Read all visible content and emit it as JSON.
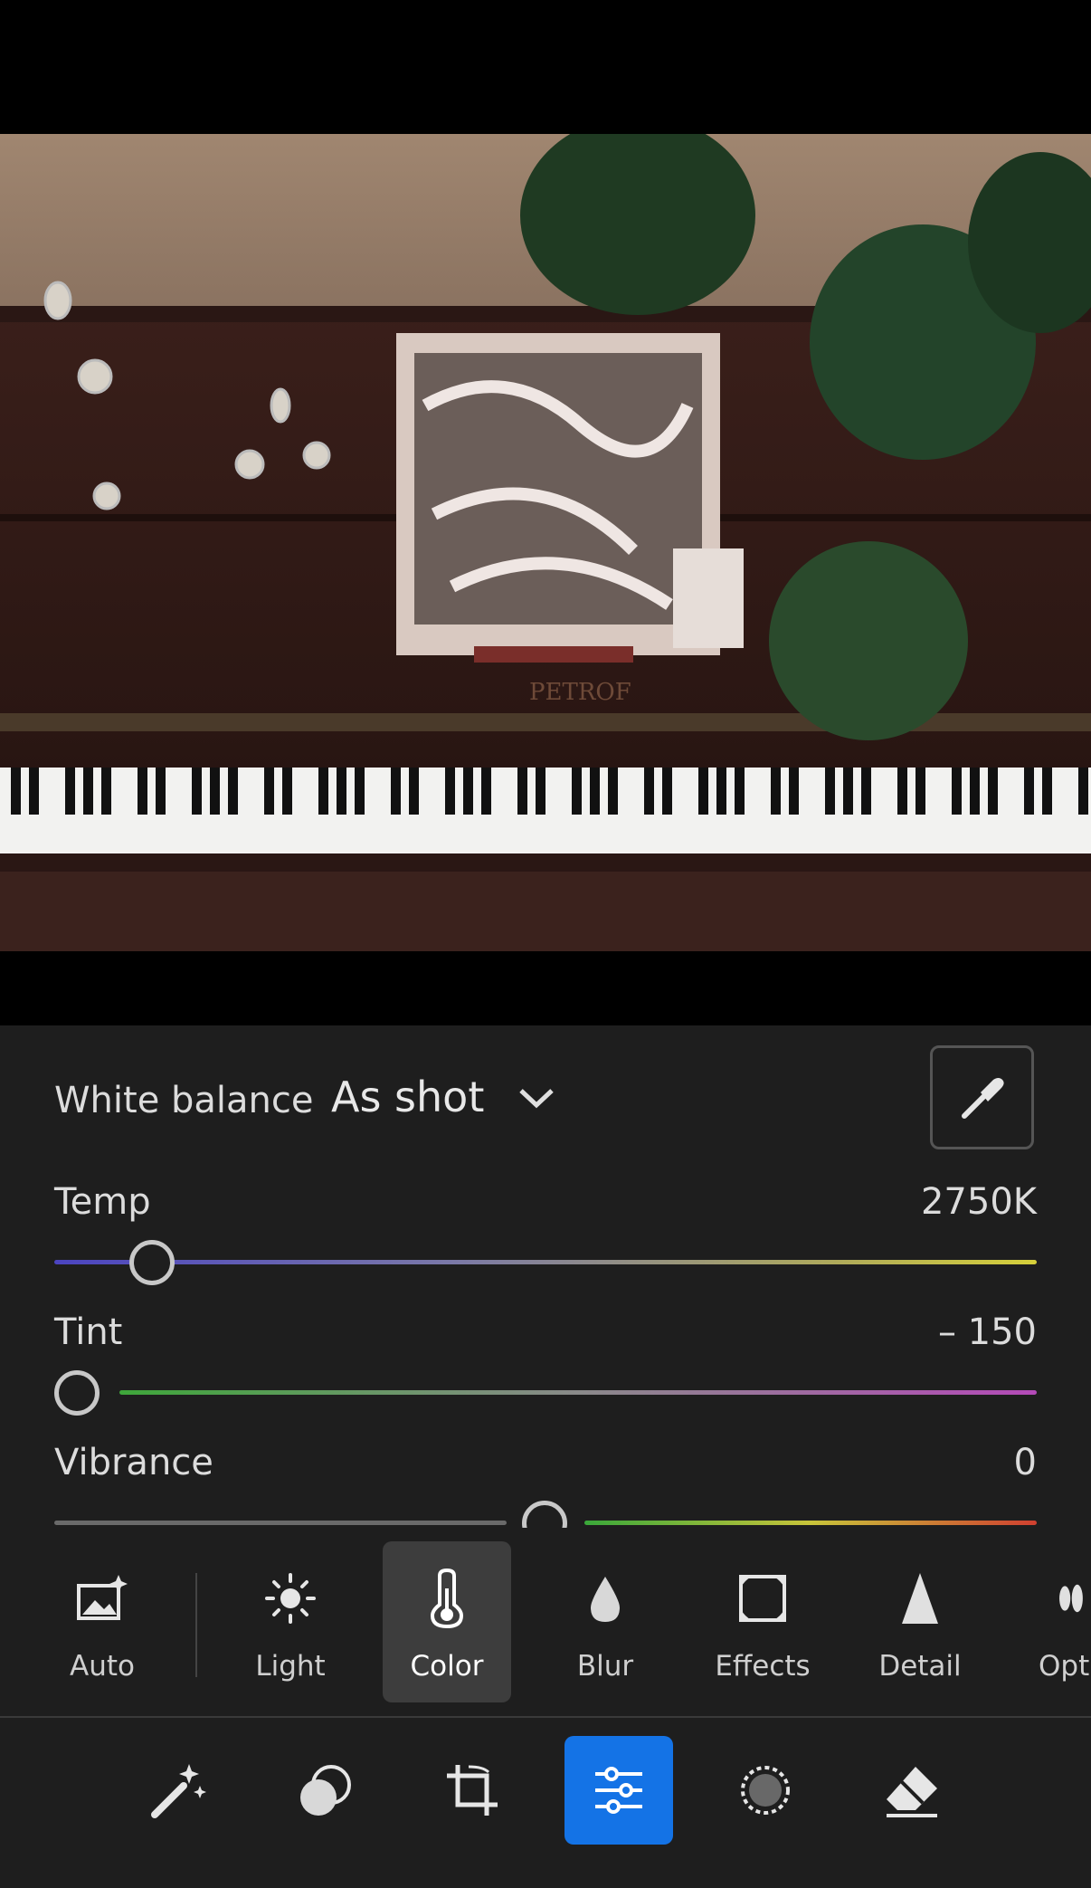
{
  "white_balance": {
    "label": "White balance",
    "preset": "As shot"
  },
  "sliders": [
    {
      "name": "Temp",
      "value_text": "2750K",
      "position": 0.1
    },
    {
      "name": "Tint",
      "value_text": "– 150",
      "position": 0.0
    },
    {
      "name": "Vibrance",
      "value_text": "0",
      "position": 0.5
    }
  ],
  "tools": [
    {
      "label": "Auto",
      "icon": "auto-image-icon"
    },
    {
      "label": "Light",
      "icon": "sun-icon"
    },
    {
      "label": "Color",
      "icon": "thermometer-icon"
    },
    {
      "label": "Blur",
      "icon": "droplet-icon"
    },
    {
      "label": "Effects",
      "icon": "effects-icon"
    },
    {
      "label": "Detail",
      "icon": "triangle-icon"
    },
    {
      "label": "Opti",
      "icon": "optics-icon"
    }
  ],
  "active_tool": "Color",
  "bottom_bar": [
    "magic-wand-icon",
    "heal-icon",
    "crop-icon",
    "adjust-sliders-icon",
    "masking-icon",
    "eraser-icon"
  ],
  "active_bottom": "adjust-sliders-icon",
  "colors": {
    "accent": "#1473e6",
    "panel": "#1e1e1e"
  },
  "photo": {
    "brand_text": "PETROF"
  }
}
